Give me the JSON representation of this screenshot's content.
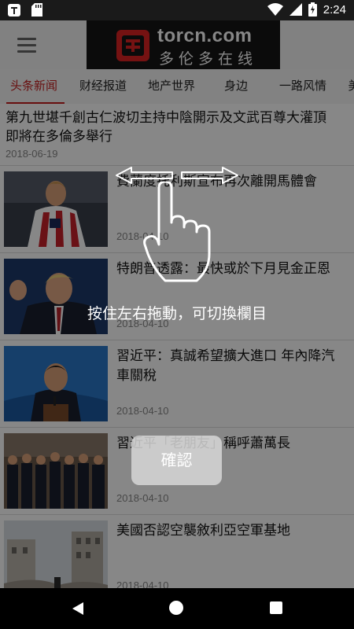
{
  "status_bar": {
    "time": "2:24",
    "icons": [
      "notification-t-icon",
      "sd-card-icon",
      "wifi-icon",
      "signal-icon",
      "battery-charging-icon"
    ]
  },
  "app_bar": {
    "logo_text": "torcn.com",
    "logo_subtext": "多伦多在线",
    "menu_icon": "hamburger-icon"
  },
  "tabs": [
    {
      "label": "头条新闻",
      "active": true
    },
    {
      "label": "财经报道",
      "active": false
    },
    {
      "label": "地产世界",
      "active": false
    },
    {
      "label": "身边",
      "active": false
    },
    {
      "label": "一路风情",
      "active": false
    },
    {
      "label": "美",
      "active": false
    }
  ],
  "lead_article": {
    "title": "第九世堪千創古仁波切主持中陰開示及文武百尊大灌頂即將在多倫多舉行",
    "date": "2018-06-19"
  },
  "articles": [
    {
      "title": "費蘭度托利斯宣布再次離開馬體會",
      "date": "2018-04-10",
      "thumb": "football-player-photo"
    },
    {
      "title": "特朗普透露：最快或於下月見金正恩",
      "date": "2018-04-10",
      "thumb": "trump-photo"
    },
    {
      "title": "習近平：真誠希望擴大進口 年內降汽車關稅",
      "date": "2018-04-10",
      "thumb": "xi-speech-photo"
    },
    {
      "title": "習近平「老朋友」稱呼蕭萬長",
      "date": "2018-04-10",
      "thumb": "group-photo"
    },
    {
      "title": "美國否認空襲敘利亞空軍基地",
      "date": "2018-04-10",
      "thumb": "ruins-photo"
    }
  ],
  "overlay": {
    "hint": "按住左右拖動，可切換欄目",
    "confirm_label": "確認"
  },
  "colors": {
    "accent": "#c41e1e",
    "logo_bg": "#151515"
  }
}
